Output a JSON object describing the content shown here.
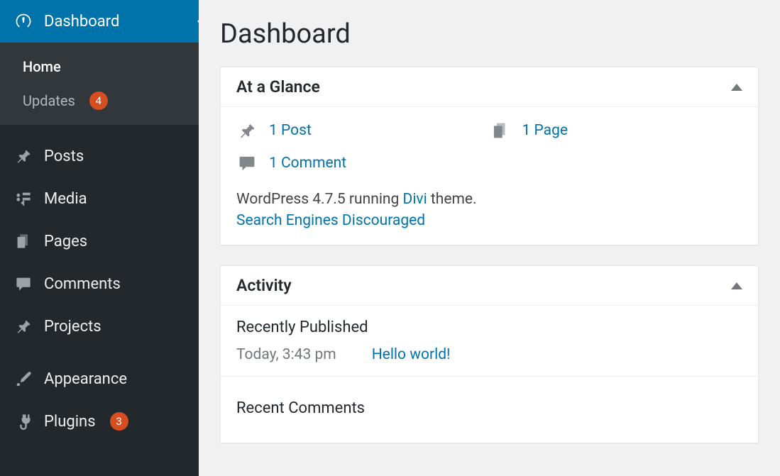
{
  "sidebar": {
    "main": [
      {
        "id": "dashboard",
        "label": "Dashboard",
        "active": true
      },
      {
        "id": "posts",
        "label": "Posts"
      },
      {
        "id": "media",
        "label": "Media"
      },
      {
        "id": "pages",
        "label": "Pages"
      },
      {
        "id": "comments",
        "label": "Comments"
      },
      {
        "id": "projects",
        "label": "Projects"
      },
      {
        "id": "appearance",
        "label": "Appearance"
      },
      {
        "id": "plugins",
        "label": "Plugins",
        "badge": "3"
      }
    ],
    "submenu": [
      {
        "id": "home",
        "label": "Home",
        "current": true
      },
      {
        "id": "updates",
        "label": "Updates",
        "badge": "4"
      }
    ]
  },
  "header": {
    "title": "Dashboard"
  },
  "glance": {
    "title": "At a Glance",
    "items": {
      "posts": "1 Post",
      "pages": "1 Page",
      "comments": "1 Comment"
    },
    "running_prefix": "WordPress 4.7.5 running ",
    "theme_name": "Divi",
    "running_suffix": " theme.",
    "seo_warning": "Search Engines Discouraged"
  },
  "activity": {
    "title": "Activity",
    "recent_published_heading": "Recently Published",
    "recent_time": "Today, 3:43 pm",
    "recent_title": "Hello world!",
    "recent_comments_heading": "Recent Comments"
  }
}
